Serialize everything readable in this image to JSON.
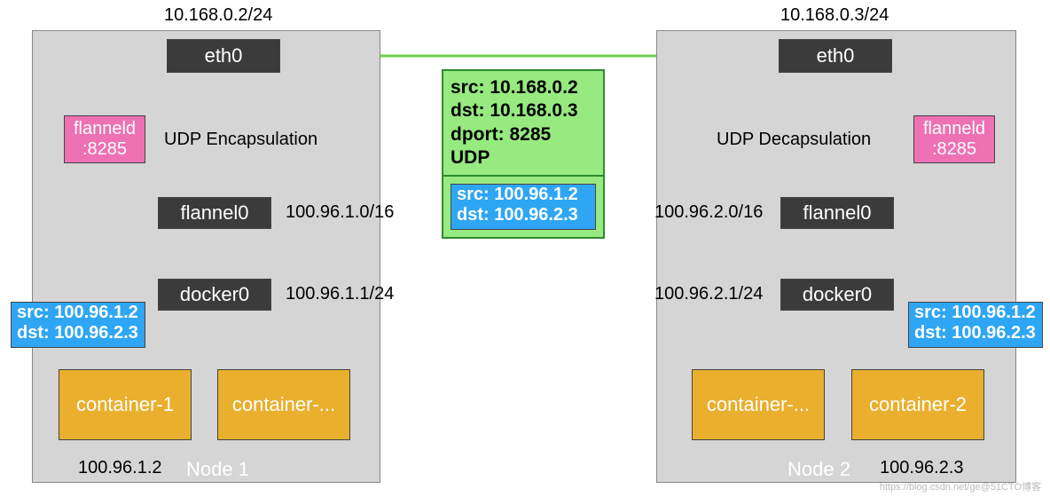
{
  "node1": {
    "title": "Node 1",
    "eth0": {
      "label": "eth0",
      "ip": "10.168.0.2/24"
    },
    "flanneld": {
      "label": "flanneld\n:8285",
      "caption": "UDP Encapsulation"
    },
    "flannel0": {
      "label": "flannel0",
      "ip": "100.96.1.0/16"
    },
    "docker0": {
      "label": "docker0",
      "ip": "100.96.1.1/24"
    },
    "containers": [
      {
        "label": "container-1",
        "ip": "100.96.1.2"
      },
      {
        "label": "container-..."
      }
    ],
    "packet_out": {
      "src": "100.96.1.2",
      "dst": "100.96.2.3"
    }
  },
  "node2": {
    "title": "Node 2",
    "eth0": {
      "label": "eth0",
      "ip": "10.168.0.3/24"
    },
    "flanneld": {
      "label": "flanneld\n:8285",
      "caption": "UDP Decapsulation"
    },
    "flannel0": {
      "label": "flannel0",
      "ip": "100.96.2.0/16"
    },
    "docker0": {
      "label": "docker0",
      "ip": "100.96.2.1/24"
    },
    "containers": [
      {
        "label": "container-..."
      },
      {
        "label": "container-2",
        "ip": "100.96.2.3"
      }
    ],
    "packet_in": {
      "src": "100.96.1.2",
      "dst": "100.96.2.3"
    }
  },
  "encapsulated_packet": {
    "outer": {
      "src": "10.168.0.2",
      "dst": "10.168.0.3",
      "dport": "8285",
      "proto": "UDP"
    },
    "inner": {
      "src": "100.96.1.2",
      "dst": "100.96.2.3"
    }
  },
  "watermark": "https://blog.csdn.net/ge@51CTO博客"
}
